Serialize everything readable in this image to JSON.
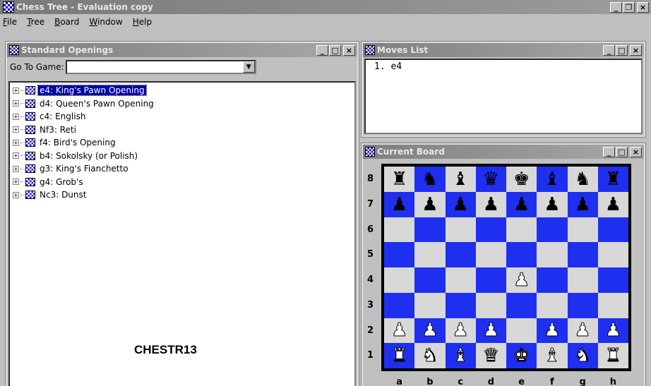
{
  "app": {
    "title": "Chess Tree  - Evaluation copy",
    "controls": {
      "minimize": "_",
      "restore": "❐",
      "close": "×"
    }
  },
  "menu": [
    "File",
    "Tree",
    "Board",
    "Window",
    "Help"
  ],
  "openings": {
    "title": "Standard Openings",
    "goto_label": "Go To Game:",
    "goto_value": "",
    "items": [
      "e4: King's Pawn Opening",
      "d4: Queen's Pawn Opening",
      "c4: English",
      "Nf3: Reti",
      "f4: Bird's Opening",
      "b4: Sokolsky (or Polish)",
      "g3: King's Fianchetto",
      "g4: Grob's",
      "Nc3: Dunst"
    ],
    "selected_index": 0,
    "caption": "CHESTR13"
  },
  "moves": {
    "title": "Moves List",
    "text": "1. e4"
  },
  "board": {
    "title": "Current Board",
    "ranks": [
      "8",
      "7",
      "6",
      "5",
      "4",
      "3",
      "2",
      "1"
    ],
    "files": [
      "a",
      "b",
      "c",
      "d",
      "e",
      "f",
      "g",
      "h"
    ],
    "position": [
      [
        "br",
        "bn",
        "bb",
        "bq",
        "bk",
        "bb",
        "bn",
        "br"
      ],
      [
        "bp",
        "bp",
        "bp",
        "bp",
        "bp",
        "bp",
        "bp",
        "bp"
      ],
      [
        "",
        "",
        "",
        "",
        "",
        "",
        "",
        ""
      ],
      [
        "",
        "",
        "",
        "",
        "",
        "",
        "",
        ""
      ],
      [
        "",
        "",
        "",
        "",
        "wp",
        "",
        "",
        ""
      ],
      [
        "",
        "",
        "",
        "",
        "",
        "",
        "",
        ""
      ],
      [
        "wp",
        "wp",
        "wp",
        "wp",
        "",
        "wp",
        "wp",
        "wp"
      ],
      [
        "wr",
        "wn",
        "wb",
        "wq",
        "wk",
        "wb",
        "wn",
        "wr"
      ]
    ],
    "light_color": "#d8d8d8",
    "dark_color": "#1f2ff0"
  }
}
